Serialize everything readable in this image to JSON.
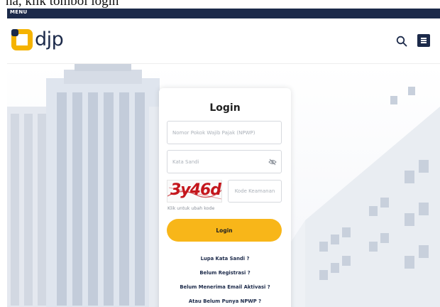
{
  "caption": {
    "text": "na, klik tombol login"
  },
  "menu_bar": {
    "label": "MENU"
  },
  "header": {
    "logo_text": "djp",
    "search_icon": "search-icon",
    "menu_icon": "hamburger-icon"
  },
  "colors": {
    "brand_navy": "#1c2a4a",
    "brand_yellow": "#f5b301",
    "button_yellow": "#f8b619",
    "captcha_red": "#c4161c"
  },
  "login": {
    "title": "Login",
    "npwp_placeholder": "Nomor Pokok Wajib Pajak (NPWP)",
    "password_placeholder": "Kata Sandi",
    "captcha_text": "3y46d",
    "code_placeholder": "Kode Keamanan",
    "captcha_hint": "Klik untuk ubah kode",
    "button_label": "Login",
    "links": [
      "Lupa Kata Sandi ?",
      "Belum Registrasi ?",
      "Belum Menerima Email Aktivasi ?",
      "Atau Belum Punya NPWP ?"
    ]
  }
}
